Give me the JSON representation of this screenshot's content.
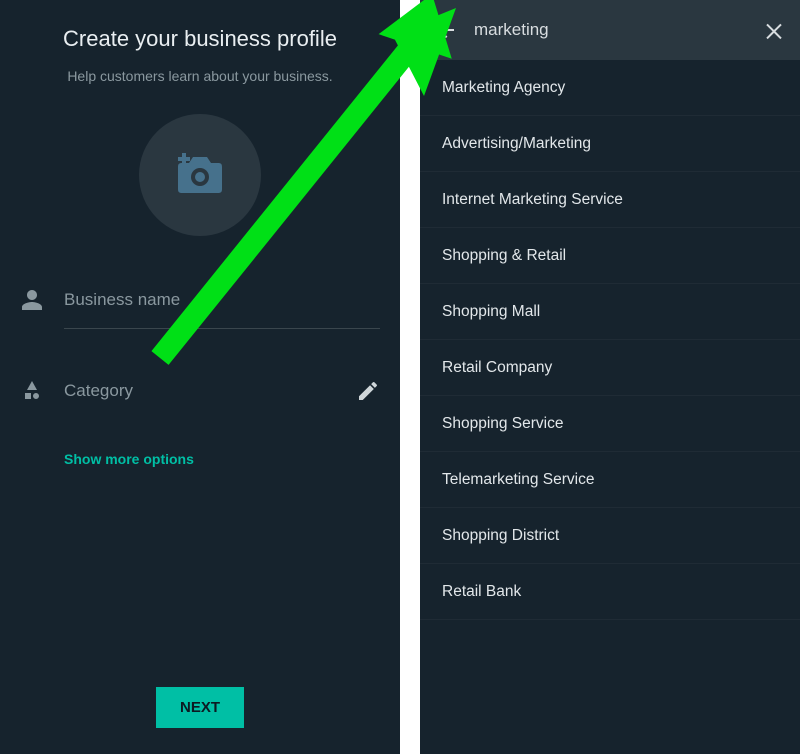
{
  "left": {
    "title": "Create your business profile",
    "subtitle": "Help customers learn about your business.",
    "business_placeholder": "Business name",
    "category_placeholder": "Category",
    "show_more": "Show more options",
    "next": "NEXT"
  },
  "right": {
    "search_value": "marketing",
    "results": [
      "Marketing Agency",
      "Advertising/Marketing",
      "Internet Marketing Service",
      "Shopping & Retail",
      "Shopping Mall",
      "Retail Company",
      "Shopping Service",
      "Telemarketing Service",
      "Shopping District",
      "Retail Bank"
    ]
  },
  "colors": {
    "accent": "#00bfa5",
    "arrow": "#00e016"
  }
}
